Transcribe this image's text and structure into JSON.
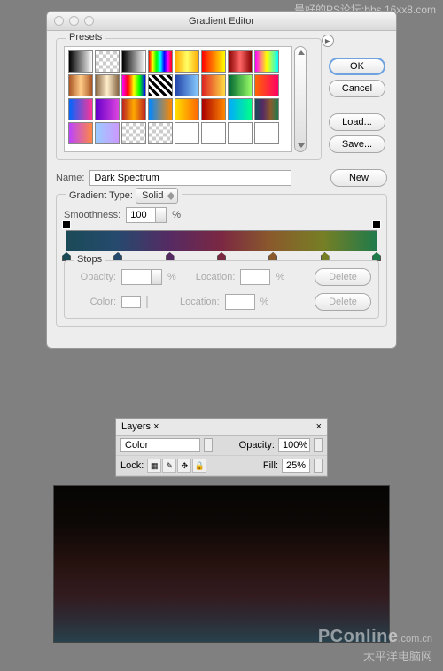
{
  "watermark": {
    "top": "最好的PS论坛:bbs.16xx8.com",
    "brand": "PConline",
    "suffix": ".com.cn",
    "cn": "太平洋电脑网"
  },
  "dialog": {
    "title": "Gradient Editor",
    "buttons": {
      "ok": "OK",
      "cancel": "Cancel",
      "load": "Load...",
      "save": "Save...",
      "new": "New"
    },
    "presets_label": "Presets",
    "name_label": "Name:",
    "name_value": "Dark Spectrum",
    "gtype_label": "Gradient Type:",
    "gtype_value": "Solid",
    "smooth_label": "Smoothness:",
    "smooth_value": "100",
    "pct": "%",
    "stops": {
      "legend": "Stops",
      "opacity": "Opacity:",
      "color": "Color:",
      "location": "Location:",
      "delete": "Delete"
    }
  },
  "layers": {
    "tab": "Layers ×",
    "close": "×",
    "blend": "Color",
    "opacity_label": "Opacity:",
    "opacity_value": "100%",
    "lock_label": "Lock:",
    "fill_label": "Fill:",
    "fill_value": "25%"
  },
  "presets": [
    "linear-gradient(90deg,#000,#fff)",
    "repeating-conic-gradient(#ccc 0 25%,#fff 0 50%) 0/8px 8px",
    "linear-gradient(90deg,#000,#fff)",
    "linear-gradient(90deg,#f00,#ff0,#0f0,#0ff,#00f,#f0f,#f00)",
    "linear-gradient(90deg,#fa0,#ff6,#fa0)",
    "linear-gradient(90deg,#f00,#ff0)",
    "linear-gradient(90deg,#800,#f66,#800)",
    "linear-gradient(90deg,#f0f,#ff0,#0ff)",
    "linear-gradient(90deg,#a52,#fc8,#a52)",
    "linear-gradient(90deg,#864,#fec,#864)",
    "linear-gradient(90deg,#f0f,#f00,#ff0,#0f0,#00f)",
    "repeating-linear-gradient(45deg,#000 0 3px,#fff 3px 6px)",
    "linear-gradient(90deg,#24a,#8cf)",
    "linear-gradient(90deg,#d22,#fd4)",
    "linear-gradient(90deg,#063,#9f6)",
    "linear-gradient(90deg,#f60,#f06)",
    "linear-gradient(90deg,#06f,#f39)",
    "linear-gradient(90deg,#60c,#d4d)",
    "linear-gradient(90deg,#b22,#fa0,#b22)",
    "linear-gradient(90deg,#08f,#f80)",
    "linear-gradient(90deg,#fd0,#f60)",
    "linear-gradient(90deg,#a00,#f80)",
    "linear-gradient(90deg,#0af,#0f8)",
    "linear-gradient(90deg,#1b4a57,#552a63,#8a5a2c,#1f7a4b)",
    "linear-gradient(90deg,#b4f,#f84)",
    "linear-gradient(90deg,#9cf,#c9f)",
    "repeating-conic-gradient(#ccc 0 25%,#fff 0 50%) 0/8px 8px",
    "repeating-conic-gradient(#ccc 0 25%,#fff 0 50%) 0/8px 8px",
    "linear-gradient(#fff,#fff)",
    "linear-gradient(#fff,#fff)",
    "linear-gradient(#fff,#fff)",
    "linear-gradient(#fff,#fff)"
  ],
  "cstops": [
    0,
    16.6,
    33.3,
    50,
    66.6,
    83.3,
    100
  ],
  "cstop_colors": [
    "#1b4a57",
    "#254a6e",
    "#552a63",
    "#7b2842",
    "#8a5a2c",
    "#767f25",
    "#1f7a4b"
  ]
}
